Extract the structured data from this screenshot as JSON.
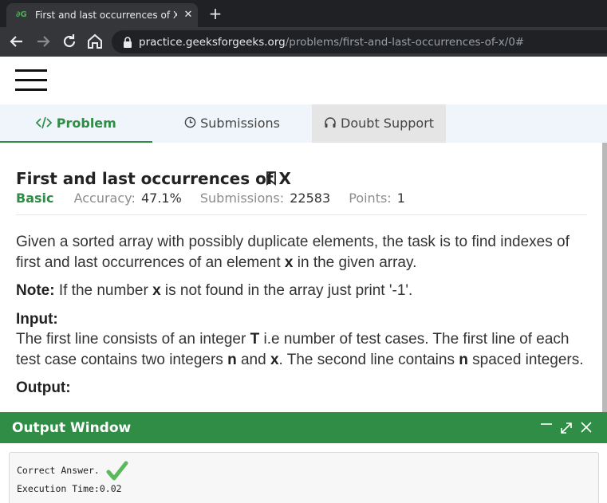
{
  "browser": {
    "tab_title": "First and last occurrences of X | P",
    "favicon": "geeksforgeeks-icon",
    "close_glyph": "✕",
    "new_tab_glyph": "+",
    "url_host": "practice.geeksforgeeks.org",
    "url_path": "/problems/first-and-last-occurrences-of-x/0#"
  },
  "tabs": [
    {
      "label": "Problem",
      "icon": "code-icon",
      "active": true
    },
    {
      "label": "Submissions",
      "icon": "clock-icon",
      "active": false
    },
    {
      "label": "Doubt Support",
      "icon": "headset-icon",
      "active": false
    }
  ],
  "problem": {
    "title": "First and last occurrences of X",
    "level": "Basic",
    "accuracy_label": "Accuracy:",
    "accuracy_value": "47.1%",
    "submissions_label": "Submissions:",
    "submissions_value": "22583",
    "points_label": "Points:",
    "points_value": "1",
    "intro_a": "Given a sorted array with possibly duplicate elements, the task is to find indexes of first and last occurrences of an element ",
    "intro_x": "x",
    "intro_b": " in the given array.",
    "note_label": "Note:",
    "note_a": " If the number ",
    "note_x": "x",
    "note_b": " is not found in the array just print '-1'.",
    "input_heading": "Input:",
    "input_a": "The first line consists of an integer ",
    "input_t": "T",
    "input_b": " i.e number of test cases. The first line of each test case contains two integers ",
    "input_n": "n",
    "input_c": " and ",
    "input_x": "x",
    "input_d": ". The second line contains ",
    "input_n2": "n",
    "input_e": " spaced integers.",
    "output_heading": "Output:"
  },
  "output_window": {
    "title": "Output Window",
    "result": "Correct Answer.",
    "execution": "Execution Time:0.02"
  },
  "colors": {
    "brand_green": "#2f8d46",
    "chrome_dark": "#202124"
  }
}
